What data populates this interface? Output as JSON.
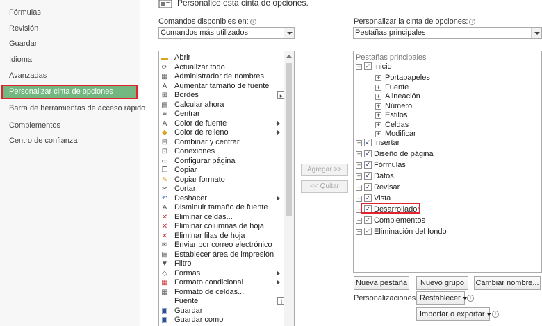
{
  "nav": {
    "items": [
      "Fórmulas",
      "Revisión",
      "Guardar",
      "Idioma",
      "Avanzadas",
      "Personalizar cinta de opciones",
      "Barra de herramientas de acceso rápido",
      "Complementos",
      "Centro de confianza"
    ],
    "selected_index": 5
  },
  "header": {
    "text": "Personalice esta cinta de opciones."
  },
  "commands": {
    "label": "Comandos disponibles en:",
    "dropdown_value": "Comandos más utilizados",
    "items": [
      "Abrir",
      "Actualizar todo",
      "Administrador de nombres",
      "Aumentar tamaño de fuente",
      "Bordes",
      "Calcular ahora",
      "Centrar",
      "Color de fuente",
      "Color de relleno",
      "Combinar y centrar",
      "Conexiones",
      "Configurar página",
      "Copiar",
      "Copiar formato",
      "Cortar",
      "Deshacer",
      "Disminuir tamaño de fuente",
      "Eliminar celdas...",
      "Eliminar columnas de hoja",
      "Eliminar filas de hoja",
      "Enviar por correo electrónico",
      "Establecer área de impresión",
      "Filtro",
      "Formas",
      "Formato condicional",
      "Formato de celdas...",
      "Fuente",
      "Guardar",
      "Guardar como"
    ]
  },
  "middle": {
    "add_label": "Agregar >>",
    "remove_label": "<< Quitar"
  },
  "ribbon": {
    "label": "Personalizar la cinta de opciones:",
    "dropdown_value": "Pestañas principales",
    "tree_header": "Pestañas principales",
    "inicio": {
      "label": "Inicio",
      "groups": [
        "Portapapeles",
        "Fuente",
        "Alineación",
        "Número",
        "Estilos",
        "Celdas",
        "Modificar"
      ]
    },
    "tabs": [
      "Insertar",
      "Diseño de página",
      "Fórmulas",
      "Datos",
      "Revisar",
      "Vista",
      "Desarrollador",
      "Complementos",
      "Eliminación del fondo"
    ],
    "highlighted_tab": "Desarrollador"
  },
  "buttons": {
    "new_tab": "Nueva pestaña",
    "new_group": "Nuevo grupo",
    "rename": "Cambiar nombre...",
    "customizations_label": "Personalizaciones:",
    "reset": "Restablecer",
    "import_export": "Importar o exportar"
  },
  "colors": {
    "selected_bg": "#73b880",
    "highlight_border": "#e0232e",
    "check": "#1d3e78"
  }
}
